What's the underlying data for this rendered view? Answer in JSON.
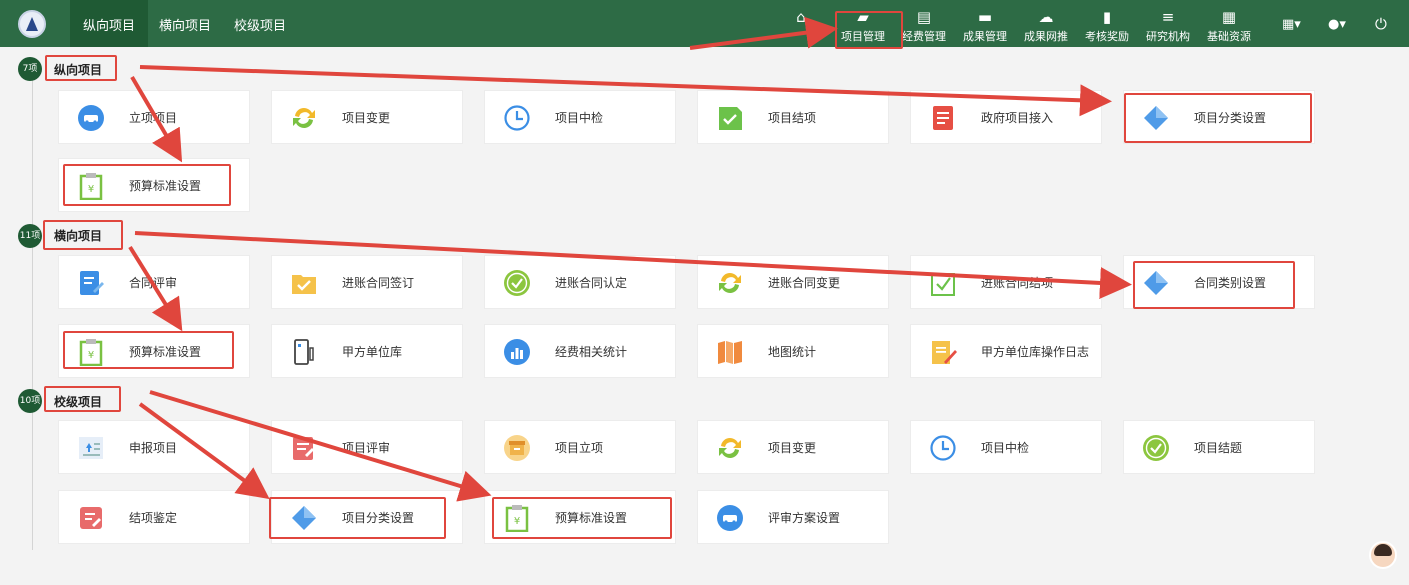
{
  "header": {
    "tabs": [
      {
        "label": "纵向项目"
      },
      {
        "label": "横向项目"
      },
      {
        "label": "校级项目"
      }
    ],
    "nav": [
      {
        "label": "首页",
        "icon": "home-icon"
      },
      {
        "label": "项目管理",
        "icon": "folder-icon"
      },
      {
        "label": "经费管理",
        "icon": "ledger-icon"
      },
      {
        "label": "成果管理",
        "icon": "drive-icon"
      },
      {
        "label": "成果网推",
        "icon": "cloud-upload-icon"
      },
      {
        "label": "考核奖励",
        "icon": "bar-chart-icon"
      },
      {
        "label": "研究机构",
        "icon": "server-icon"
      },
      {
        "label": "基础资源",
        "icon": "grid-icon"
      }
    ],
    "right_icons": [
      {
        "icon": "qrcode-icon",
        "glyph": "▦▾"
      },
      {
        "icon": "user-icon",
        "glyph": "●▾"
      },
      {
        "icon": "power-icon",
        "glyph": "⏻"
      }
    ]
  },
  "sections": [
    {
      "badge": "7项",
      "title": "纵向项目",
      "items": [
        {
          "label": "立项项目",
          "icon": "car-icon",
          "color": "#3b8ee5"
        },
        {
          "label": "项目变更",
          "icon": "refresh-arrows-icon",
          "color": "#f2b92b"
        },
        {
          "label": "项目中检",
          "icon": "clock-icon",
          "color": "#3b8ee5"
        },
        {
          "label": "项目结项",
          "icon": "check-doc-icon",
          "color": "#6cc24a"
        },
        {
          "label": "政府项目接入",
          "icon": "gov-doc-icon",
          "color": "#e64f44"
        },
        {
          "label": "项目分类设置",
          "icon": "diamond-icon",
          "color": "#4f9be8"
        },
        {
          "label": "预算标准设置",
          "icon": "yuan-clipboard-icon",
          "color": "#7ac142"
        }
      ]
    },
    {
      "badge": "11项",
      "title": "横向项目",
      "items": [
        {
          "label": "合同评审",
          "icon": "edit-doc-icon",
          "color": "#3b8ee5"
        },
        {
          "label": "进账合同签订",
          "icon": "check-folder-icon",
          "color": "#f5c24a"
        },
        {
          "label": "进账合同认定",
          "icon": "check-circle-icon",
          "color": "#8cc63f"
        },
        {
          "label": "进账合同变更",
          "icon": "refresh-arrows-icon",
          "color": "#f2b92b"
        },
        {
          "label": "进账合同结项",
          "icon": "check-box-icon",
          "color": "#6cc24a"
        },
        {
          "label": "合同类别设置",
          "icon": "diamond-icon",
          "color": "#4f9be8"
        },
        {
          "label": "预算标准设置",
          "icon": "yuan-clipboard-icon",
          "color": "#7ac142"
        },
        {
          "label": "甲方单位库",
          "icon": "phone-doc-icon",
          "color": "#444444"
        },
        {
          "label": "经费相关统计",
          "icon": "stats-circle-icon",
          "color": "#3b8ee5"
        },
        {
          "label": "地图统计",
          "icon": "map-icon",
          "color": "#f08a3e"
        },
        {
          "label": "甲方单位库操作日志",
          "icon": "notepad-icon",
          "color": "#f5c24a"
        }
      ]
    },
    {
      "badge": "10项",
      "title": "校级项目",
      "items": [
        {
          "label": "申报项目",
          "icon": "upload-list-icon",
          "color": "#3b8ee5"
        },
        {
          "label": "项目评审",
          "icon": "review-doc-icon",
          "color": "#e86b6b"
        },
        {
          "label": "项目立项",
          "icon": "archive-icon",
          "color": "#f0b34a"
        },
        {
          "label": "项目变更",
          "icon": "refresh-arrows-icon",
          "color": "#f2b92b"
        },
        {
          "label": "项目中检",
          "icon": "clock-icon",
          "color": "#3b8ee5"
        },
        {
          "label": "项目结题",
          "icon": "check-circle-icon",
          "color": "#8cc63f"
        },
        {
          "label": "结项鉴定",
          "icon": "edit-square-icon",
          "color": "#e86b6b"
        },
        {
          "label": "项目分类设置",
          "icon": "diamond-icon",
          "color": "#4f9be8"
        },
        {
          "label": "预算标准设置",
          "icon": "yuan-clipboard-icon",
          "color": "#7ac142"
        },
        {
          "label": "评审方案设置",
          "icon": "car-icon",
          "color": "#3b8ee5"
        }
      ]
    }
  ],
  "annotation_color": "#e0463d"
}
